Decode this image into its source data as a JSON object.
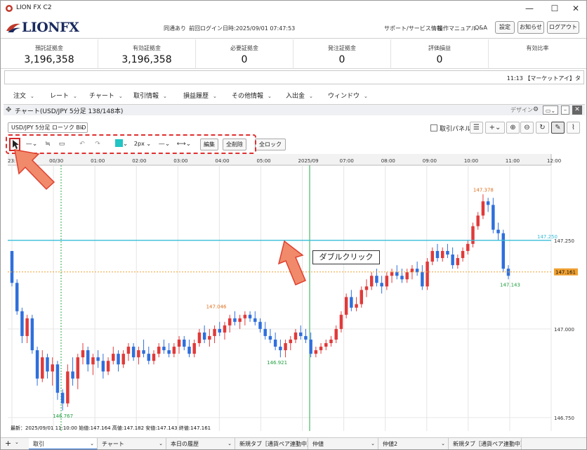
{
  "window": {
    "title": "LION FX C2",
    "minimize": "—",
    "maximize": "☐",
    "close": "✕"
  },
  "header": {
    "logo_text": "LIONFX",
    "connection_status": "同通あり",
    "last_login": "前回ログイン日時:2025/09/01 07:47:53",
    "support_link": "サポート/サービス情報",
    "manual_link": "操作マニュアル",
    "qa_link": "Q&A",
    "settings_button": "設定",
    "notice_button": "お知らせ",
    "logout_button": "ログアウト"
  },
  "summary": [
    {
      "label": "預託証拠金",
      "value": "3,196,358"
    },
    {
      "label": "有効証拠金",
      "value": "3,196,358"
    },
    {
      "label": "必要証拠金",
      "value": "0"
    },
    {
      "label": "発注証拠金",
      "value": "0"
    },
    {
      "label": "評価損益",
      "value": "0"
    },
    {
      "label": "有効比率",
      "value": ""
    }
  ],
  "ticker": {
    "text": "11:13 【マーケットアイ】タ"
  },
  "menu": [
    "注文",
    "レート",
    "チャート",
    "取引情報",
    "損益履歴",
    "その他情報",
    "入出金",
    "ウィンドウ"
  ],
  "chart_window": {
    "title": "チャート(USD/JPY 5分足 138/148本)",
    "design_label": "デザイン",
    "symbol_select": "USD/JPY 5分足 ローソク BID",
    "trade_panel_label": "取引パネル"
  },
  "drawing_toolbar": {
    "width_select": "2px",
    "edit_button": "編集",
    "delete_all_button": "全削除",
    "lock_all_button": "全ロック"
  },
  "chart_data": {
    "type": "candlestick",
    "symbol": "USD/JPY",
    "timeframe": "5分足",
    "x_tick_labels": [
      "23:",
      "00/30",
      "01:00",
      "02:00",
      "03:00",
      "04:00",
      "05:00",
      "2025/09",
      "07:00",
      "08:00",
      "09:00",
      "10:00",
      "11:00",
      "12:00"
    ],
    "y_tick_labels": [
      "147.250",
      "147.000",
      "146.750"
    ],
    "ylim": [
      146.72,
      147.45
    ],
    "candles_ohlc": [
      [
        147.22,
        147.22,
        147.12,
        147.13
      ],
      [
        147.13,
        147.14,
        147.04,
        147.05
      ],
      [
        147.05,
        147.06,
        146.96,
        146.98
      ],
      [
        146.98,
        147.04,
        146.96,
        147.03
      ],
      [
        147.03,
        147.04,
        146.93,
        146.94
      ],
      [
        146.94,
        146.95,
        146.84,
        146.86
      ],
      [
        146.86,
        146.94,
        146.85,
        146.92
      ],
      [
        146.92,
        146.93,
        146.86,
        146.88
      ],
      [
        146.88,
        146.92,
        146.84,
        146.9
      ],
      [
        146.9,
        146.91,
        146.8,
        146.82
      ],
      [
        146.82,
        146.83,
        146.77,
        146.79
      ],
      [
        146.79,
        146.9,
        146.78,
        146.88
      ],
      [
        146.88,
        146.92,
        146.84,
        146.86
      ],
      [
        146.86,
        146.93,
        146.83,
        146.92
      ],
      [
        146.92,
        146.96,
        146.9,
        146.94
      ],
      [
        146.94,
        146.95,
        146.88,
        146.9
      ],
      [
        146.9,
        146.93,
        146.87,
        146.92
      ],
      [
        146.92,
        146.94,
        146.89,
        146.91
      ],
      [
        146.91,
        146.93,
        146.86,
        146.88
      ],
      [
        146.88,
        146.92,
        146.87,
        146.91
      ],
      [
        146.91,
        146.95,
        146.9,
        146.93
      ],
      [
        146.93,
        146.94,
        146.88,
        146.9
      ],
      [
        146.9,
        146.94,
        146.89,
        146.93
      ],
      [
        146.93,
        146.96,
        146.91,
        146.95
      ],
      [
        146.95,
        146.96,
        146.91,
        146.92
      ],
      [
        146.92,
        146.95,
        146.9,
        146.94
      ],
      [
        146.94,
        146.97,
        146.92,
        146.93
      ],
      [
        146.93,
        146.95,
        146.9,
        146.91
      ],
      [
        146.91,
        146.94,
        146.9,
        146.93
      ],
      [
        146.93,
        146.96,
        146.92,
        146.95
      ],
      [
        146.95,
        146.97,
        146.93,
        146.94
      ],
      [
        146.94,
        146.96,
        146.92,
        146.93
      ],
      [
        146.93,
        146.96,
        146.92,
        146.95
      ],
      [
        146.95,
        146.98,
        146.93,
        146.97
      ],
      [
        146.97,
        146.98,
        146.94,
        146.95
      ],
      [
        146.95,
        146.97,
        146.92,
        146.93
      ],
      [
        146.93,
        146.97,
        146.92,
        146.96
      ],
      [
        146.96,
        147.0,
        146.95,
        146.99
      ],
      [
        146.99,
        147.01,
        146.96,
        146.97
      ],
      [
        146.97,
        147.0,
        146.95,
        146.98
      ],
      [
        146.98,
        147.01,
        146.96,
        147.0
      ],
      [
        147.0,
        147.02,
        146.98,
        146.99
      ],
      [
        146.99,
        147.02,
        146.97,
        147.01
      ],
      [
        147.01,
        147.04,
        146.99,
        147.03
      ],
      [
        147.03,
        147.05,
        147.01,
        147.02
      ],
      [
        147.02,
        147.04,
        147.0,
        147.03
      ],
      [
        147.03,
        147.05,
        147.01,
        147.04
      ],
      [
        147.04,
        147.05,
        147.02,
        147.03
      ],
      [
        147.03,
        147.05,
        147.01,
        147.02
      ],
      [
        147.02,
        147.03,
        146.99,
        147.0
      ],
      [
        147.0,
        147.02,
        146.97,
        146.98
      ],
      [
        146.98,
        147.0,
        146.96,
        146.97
      ],
      [
        146.97,
        146.99,
        146.94,
        146.95
      ],
      [
        146.95,
        146.97,
        146.92,
        146.94
      ],
      [
        146.94,
        146.97,
        146.92,
        146.96
      ],
      [
        146.96,
        146.98,
        146.94,
        146.97
      ],
      [
        146.97,
        147.0,
        146.96,
        146.99
      ],
      [
        146.99,
        147.01,
        146.97,
        146.98
      ],
      [
        146.98,
        147.0,
        146.96,
        146.97
      ],
      [
        146.97,
        146.99,
        146.92,
        146.93
      ],
      [
        146.93,
        146.95,
        146.92,
        146.94
      ],
      [
        146.94,
        146.96,
        146.93,
        146.95
      ],
      [
        146.95,
        146.97,
        146.94,
        146.96
      ],
      [
        146.96,
        146.98,
        146.95,
        146.97
      ],
      [
        146.97,
        147.01,
        146.96,
        147.0
      ],
      [
        147.0,
        147.05,
        146.99,
        147.04
      ],
      [
        147.04,
        147.1,
        147.03,
        147.09
      ],
      [
        147.09,
        147.11,
        147.05,
        147.06
      ],
      [
        147.06,
        147.09,
        147.05,
        147.07
      ],
      [
        147.07,
        147.12,
        147.06,
        147.11
      ],
      [
        147.11,
        147.14,
        147.09,
        147.12
      ],
      [
        147.12,
        147.16,
        147.11,
        147.15
      ],
      [
        147.15,
        147.17,
        147.12,
        147.13
      ],
      [
        147.13,
        147.15,
        147.1,
        147.12
      ],
      [
        147.12,
        147.16,
        147.11,
        147.15
      ],
      [
        147.15,
        147.17,
        147.13,
        147.16
      ],
      [
        147.16,
        147.18,
        147.14,
        147.15
      ],
      [
        147.15,
        147.17,
        147.13,
        147.14
      ],
      [
        147.14,
        147.17,
        147.13,
        147.16
      ],
      [
        147.16,
        147.18,
        147.14,
        147.17
      ],
      [
        147.17,
        147.19,
        147.15,
        147.16
      ],
      [
        147.16,
        147.18,
        147.11,
        147.12
      ],
      [
        147.12,
        147.2,
        147.11,
        147.19
      ],
      [
        147.19,
        147.23,
        147.18,
        147.22
      ],
      [
        147.22,
        147.24,
        147.19,
        147.2
      ],
      [
        147.2,
        147.23,
        147.19,
        147.22
      ],
      [
        147.22,
        147.24,
        147.2,
        147.21
      ],
      [
        147.21,
        147.23,
        147.17,
        147.18
      ],
      [
        147.18,
        147.21,
        147.17,
        147.2
      ],
      [
        147.2,
        147.23,
        147.19,
        147.22
      ],
      [
        147.22,
        147.25,
        147.21,
        147.24
      ],
      [
        147.24,
        147.3,
        147.23,
        147.29
      ],
      [
        147.29,
        147.33,
        147.28,
        147.32
      ],
      [
        147.32,
        147.38,
        147.31,
        147.36
      ],
      [
        147.36,
        147.37,
        147.33,
        147.35
      ],
      [
        147.35,
        147.37,
        147.27,
        147.28
      ],
      [
        147.28,
        147.3,
        147.25,
        147.27
      ],
      [
        147.27,
        147.28,
        147.16,
        147.17
      ],
      [
        147.17,
        147.18,
        147.14,
        147.15
      ]
    ],
    "annotations": {
      "high_label": "147.378",
      "low_label": "146.767",
      "mid_high_label": "147.046",
      "mid_low_label": "146.921",
      "end_low_label": "147.143"
    },
    "horizontal_line": {
      "label": "147.250"
    },
    "current_price": {
      "label": "147.161"
    },
    "colors": {
      "up": "#e03a3a",
      "down": "#2f6fdc",
      "hline": "#38bcd8",
      "price_line": "#f0a030",
      "vline": "#2aa84a"
    },
    "status_line": "最新：2025/09/01 11:10:00 始値:147.164 高値:147.182 安値:147.143 終値:147.161"
  },
  "annotation": {
    "callout_text": "ダブルクリック"
  },
  "bottom_tabs": [
    "取引",
    "チャート",
    "本日の履歴",
    "新規タブ［通貨ペア連動中］",
    "仲値",
    "仲値2",
    "新規タブ［通貨ペア連動中］"
  ]
}
